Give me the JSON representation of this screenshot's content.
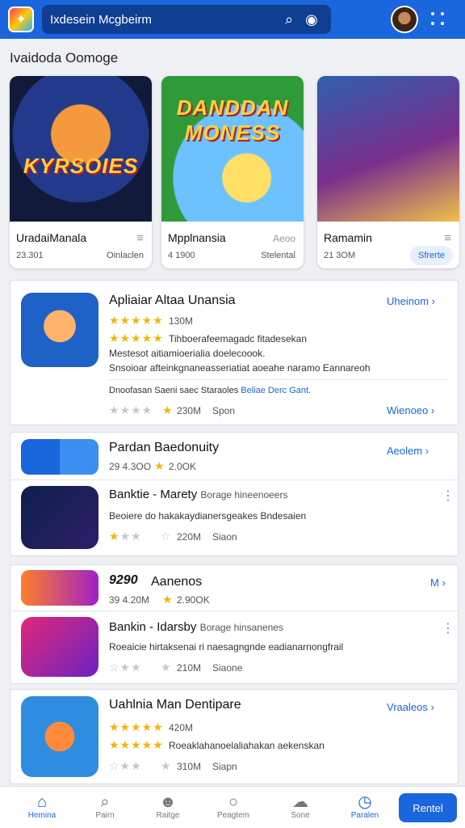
{
  "header": {
    "search_text": "Ixdesein Mcgbeirm",
    "icons": [
      "app-logo-icon",
      "search-icon",
      "voice-icon",
      "avatar",
      "grid-menu-icon"
    ]
  },
  "section": {
    "title": "Ivaidoda Oomoge"
  },
  "featured": [
    {
      "art_text": "KYRSOIES",
      "title": "UradaiManala",
      "meta": "23.301",
      "sub": "Oinlaclen"
    },
    {
      "art_text": "DANDDAN MONESS",
      "title": "Mpplnansia",
      "meta": "4 1900",
      "sub": "Stelental",
      "badge": "Aeoo"
    },
    {
      "title": "Ramamin",
      "meta": "21 3OM",
      "button": "Sfrerte"
    }
  ],
  "card1": {
    "title": "Apliaiar Altaa Unansia",
    "link": "Uheinom",
    "rating_text": "130M",
    "desc1": "Tihboerafeemagadc fitadesekan",
    "desc2": "Mestesot aitiamioerialia doelecoook.",
    "desc3": "Snsoioar afteinkgnaneasseriatiat aoeahe naramo Eannareoh",
    "note": "Dnoofasan Saeni saec Staraoles",
    "note_link": "Beliae Derc Gant.",
    "size": "230M",
    "extra": "Spon",
    "link2": "Wienoeo"
  },
  "card2": {
    "title": "Pardan Baedonuity",
    "link": "Aeolem",
    "meta": "29  4.3OO",
    "rating": "2.0OK",
    "app_title": "Banktie - Marety",
    "app_sub": "Borage hineenoeers",
    "desc": "Beoiere do hakakaydianersgeakes Bndesaien",
    "size": "220M",
    "extra": "Siaon"
  },
  "card3": {
    "title": "Aanenos",
    "link": "M",
    "meta": "39  4.20M",
    "rating": "2.90OK",
    "tag": "9290",
    "app_title": "Bankin - Idarsby",
    "app_sub": "Borage hinsanenes",
    "desc": "Roeaicie hirtaksenai ri naesagngnde eadianarnongfrail",
    "size": "210M",
    "extra": "Siaone"
  },
  "card4": {
    "title": "Uahlnia Man Dentipare",
    "link": "Vraaleos",
    "rating_text": "420M",
    "desc": "Roeaklahanoelaliahakan aekenskan",
    "size": "310M",
    "extra": "Siapn"
  },
  "bottom_nav": [
    {
      "label": "Hemina",
      "icon": "home-icon"
    },
    {
      "label": "Pairn",
      "icon": "search-icon"
    },
    {
      "label": "Raitge",
      "icon": "user-icon"
    },
    {
      "label": "Peagtem",
      "icon": "circle-icon"
    },
    {
      "label": "Sone",
      "icon": "cloud-icon"
    },
    {
      "label": "Paralen",
      "icon": "clock-icon"
    }
  ],
  "cta_label": "Rentel",
  "colors": {
    "primary": "#1a66dd",
    "header": "#1a66dd",
    "star": "#f5b400"
  }
}
